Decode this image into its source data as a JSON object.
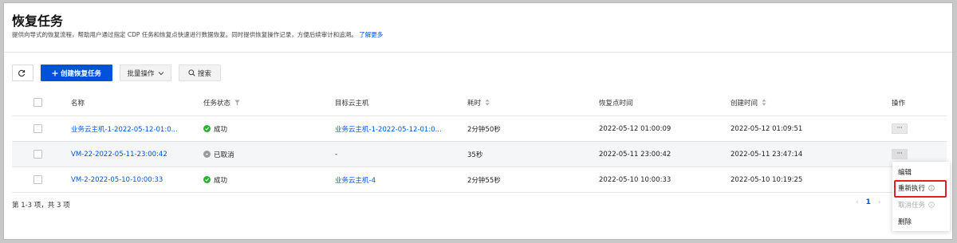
{
  "page": {
    "title": "恢复任务",
    "subtitle": "提供向导式的恢复流程，帮助用户通过指定 CDP 任务和恢复点快速进行数据恢复。同时提供恢复操作记录，方便后续审计和追溯。",
    "learn_more": "了解更多"
  },
  "toolbar": {
    "refresh_icon": "refresh-icon",
    "create_label": "创建恢复任务",
    "batch_label": "批量操作",
    "search_label": "搜索"
  },
  "table": {
    "columns": [
      "名称",
      "任务状态",
      "目标云主机",
      "耗时",
      "恢复点时间",
      "创建时间",
      "操作"
    ],
    "rows": [
      {
        "name": "业务云主机-1-2022-05-12-01:0...",
        "status": "成功",
        "target": "业务云主机-1-2022-05-12-01:0...",
        "duration": "2分钟50秒",
        "restore_point": "2022-05-12 01:00:09",
        "created": "2022-05-12 01:09:51"
      },
      {
        "name": "VM-22-2022-05-11-23:00:42",
        "status": "已取消",
        "target": "-",
        "duration": "35秒",
        "restore_point": "2022-05-11 23:00:42",
        "created": "2022-05-11 23:47:14"
      },
      {
        "name": "VM-2-2022-05-10-10:00:33",
        "status": "成功",
        "target": "业务云主机-4",
        "duration": "2分钟55秒",
        "restore_point": "2022-05-10 10:00:33",
        "created": "2022-05-10 10:19:25"
      }
    ],
    "more_label": "···"
  },
  "footer": {
    "summary": "第 1-3 项，共 3 项",
    "prev": "‹",
    "page": "1",
    "next": "›"
  },
  "dropdown": {
    "items": [
      "编辑",
      "重新执行",
      "取消任务",
      "删除"
    ]
  },
  "colors": {
    "primary": "#0052d9",
    "success": "#29b12f",
    "cancelled": "#9a9a9a",
    "highlight": "#e02020"
  }
}
